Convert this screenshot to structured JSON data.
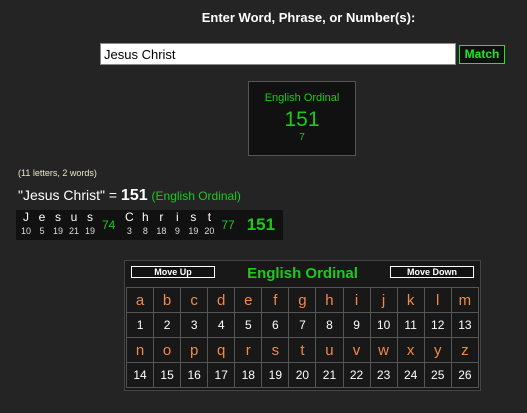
{
  "prompt": "Enter Word, Phrase, or Number(s):",
  "search": {
    "value": "Jesus Christ"
  },
  "match_label": "Match",
  "result": {
    "cipher": "English Ordinal",
    "value": "151",
    "reduced": "7"
  },
  "counts": "(11 letters, 2 words)",
  "equation": {
    "phrase": "\"Jesus Christ\" =",
    "total": "151",
    "cipher": "(English Ordinal)"
  },
  "breakdown": {
    "words": [
      {
        "letters": [
          [
            "J",
            "10"
          ],
          [
            "e",
            "5"
          ],
          [
            "s",
            "19"
          ],
          [
            "u",
            "21"
          ],
          [
            "s",
            "19"
          ]
        ],
        "sum": "74"
      },
      {
        "letters": [
          [
            "C",
            "3"
          ],
          [
            "h",
            "8"
          ],
          [
            "r",
            "18"
          ],
          [
            "i",
            "9"
          ],
          [
            "s",
            "19"
          ],
          [
            "t",
            "20"
          ]
        ],
        "sum": "77"
      }
    ],
    "total": "151"
  },
  "cipher_table": {
    "title": "English Ordinal",
    "move_up": "Move Up",
    "move_down": "Move Down",
    "rows": [
      [
        "a",
        "b",
        "c",
        "d",
        "e",
        "f",
        "g",
        "h",
        "i",
        "j",
        "k",
        "l",
        "m"
      ],
      [
        "1",
        "2",
        "3",
        "4",
        "5",
        "6",
        "7",
        "8",
        "9",
        "10",
        "11",
        "12",
        "13"
      ],
      [
        "n",
        "o",
        "p",
        "q",
        "r",
        "s",
        "t",
        "u",
        "v",
        "w",
        "x",
        "y",
        "z"
      ],
      [
        "14",
        "15",
        "16",
        "17",
        "18",
        "19",
        "20",
        "21",
        "22",
        "23",
        "24",
        "25",
        "26"
      ]
    ]
  },
  "colors": {
    "accent_green": "#1ec81e",
    "letter_orange": "#f08a4a",
    "background": "#242424"
  }
}
